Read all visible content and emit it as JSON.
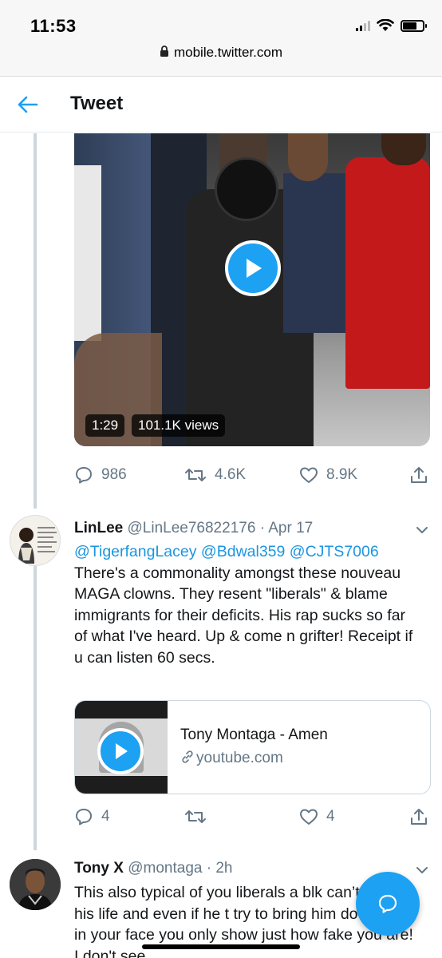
{
  "status_bar": {
    "time": "11:53"
  },
  "browser": {
    "url": "mobile.twitter.com"
  },
  "header": {
    "title": "Tweet"
  },
  "video": {
    "duration": "1:29",
    "views": "101.1K views"
  },
  "main_actions": {
    "replies": "986",
    "retweets": "4.6K",
    "likes": "8.9K"
  },
  "reply1": {
    "name": "LinLee",
    "handle": "@LinLee76822176",
    "separator": "·",
    "date": "Apr 17",
    "mentions": [
      "@TigerfangLacey",
      "@Bdwal359",
      "@CJTS7006"
    ],
    "text": "There's a commonality amongst these nouveau MAGA clowns. They resent \"liberals\" & blame immigrants for their deficits. His rap sucks so far of what I've heard. Up & come n grifter! Receipt if u can listen 60 secs.",
    "card": {
      "title": "Tony Montaga - Amen",
      "domain": "youtube.com"
    },
    "actions": {
      "replies": "4",
      "retweets": "",
      "likes": "4"
    }
  },
  "reply2": {
    "name": "Tony X",
    "handle": "@montaga",
    "separator": "·",
    "date": "2h",
    "text": "This also typical of you liberals a blk can’t change his life and even if he t try to bring him down. Pie in your face you only show just how fake you are! I don't see"
  },
  "colors": {
    "accent": "#1da1f2",
    "link": "#1b95e0",
    "muted": "#657786",
    "text": "#14171a"
  }
}
